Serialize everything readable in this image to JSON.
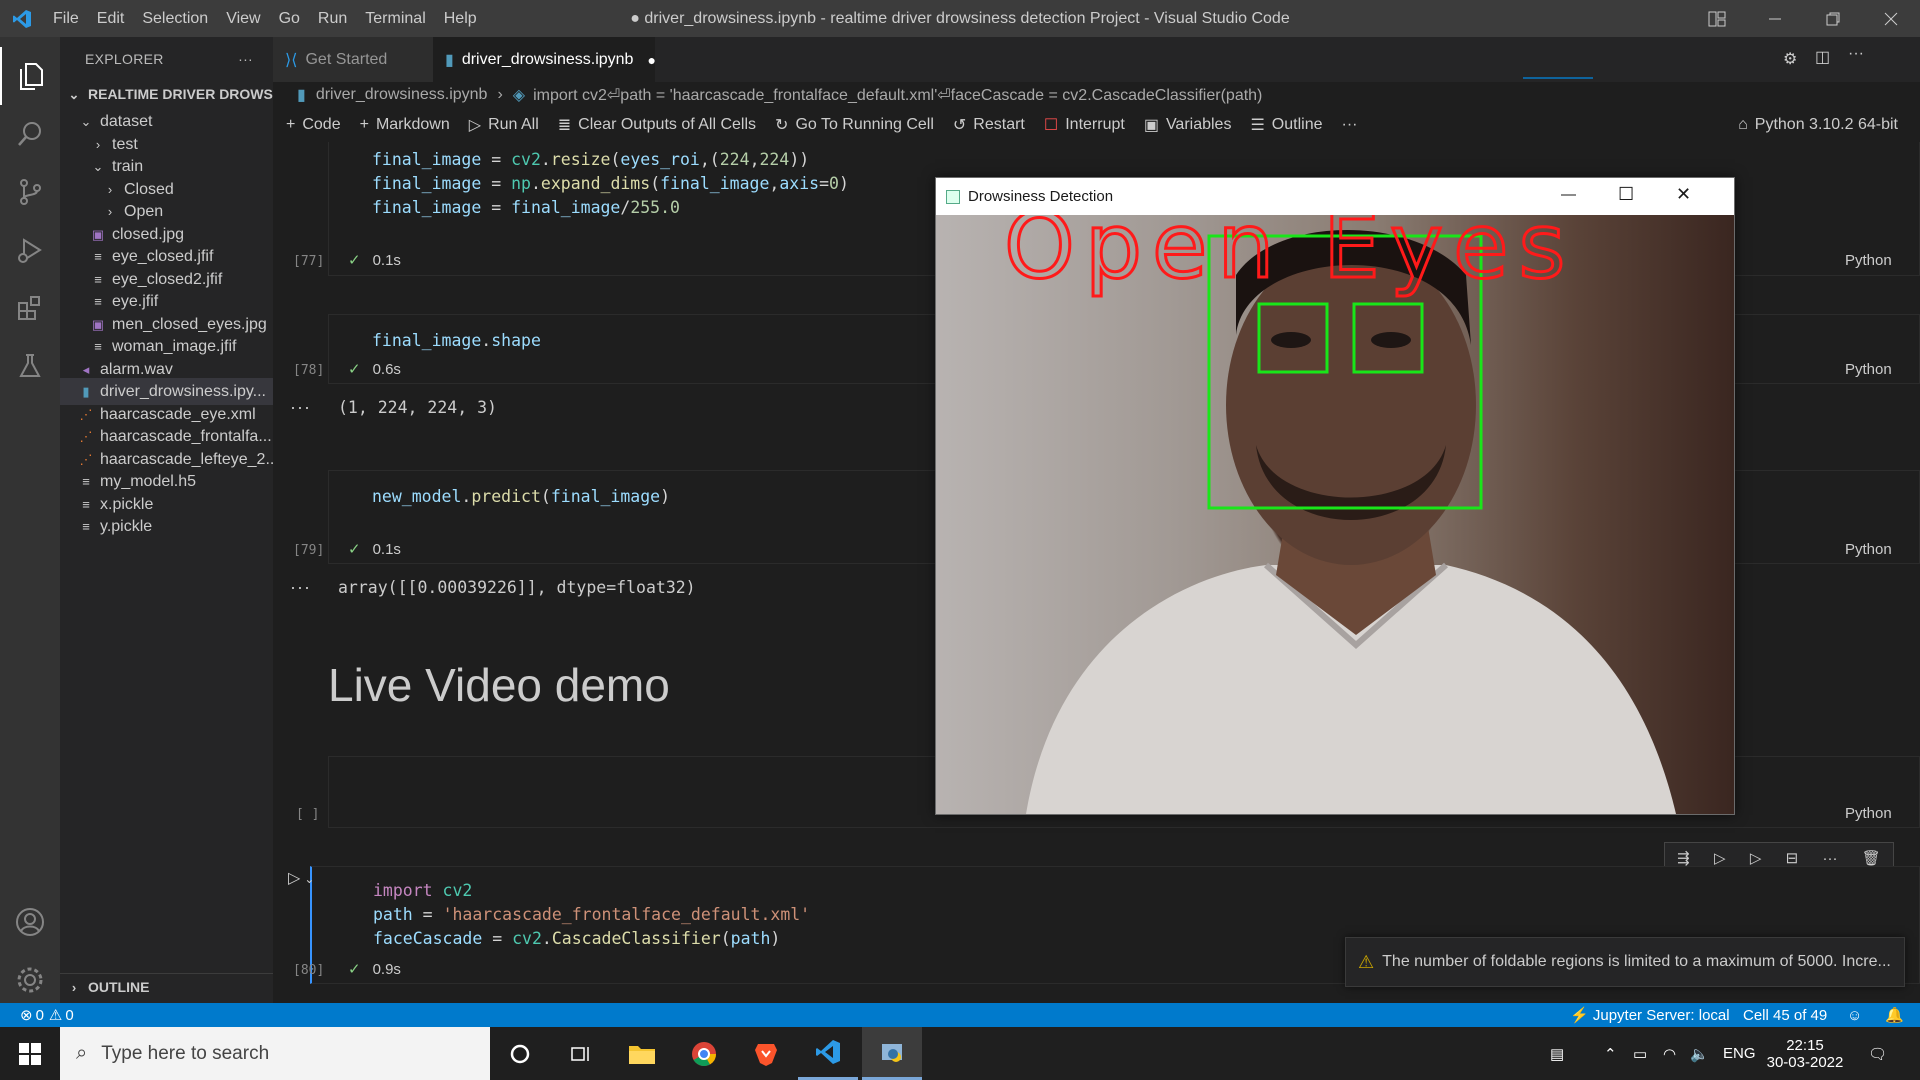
{
  "titlebar": {
    "menu": [
      "File",
      "Edit",
      "Selection",
      "View",
      "Go",
      "Run",
      "Terminal",
      "Help"
    ],
    "title": "● driver_drowsiness.ipynb - realtime driver drowsiness detection Project - Visual Studio Code"
  },
  "sidebar": {
    "header": "EXPLORER",
    "root": "REALTIME DRIVER DROWS...",
    "items": [
      {
        "label": "dataset",
        "kind": "folder-open"
      },
      {
        "label": "test",
        "kind": "folder"
      },
      {
        "label": "train",
        "kind": "folder-open"
      },
      {
        "label": "Closed",
        "kind": "folder"
      },
      {
        "label": "Open",
        "kind": "folder"
      },
      {
        "label": "closed.jpg",
        "kind": "image"
      },
      {
        "label": "eye_closed.jfif",
        "kind": "file"
      },
      {
        "label": "eye_closed2.jfif",
        "kind": "file"
      },
      {
        "label": "eye.jfif",
        "kind": "file"
      },
      {
        "label": "men_closed_eyes.jpg",
        "kind": "image"
      },
      {
        "label": "woman_image.jfif",
        "kind": "file"
      },
      {
        "label": "alarm.wav",
        "kind": "audio"
      },
      {
        "label": "driver_drowsiness.ipy...",
        "kind": "notebook"
      },
      {
        "label": "haarcascade_eye.xml",
        "kind": "rss"
      },
      {
        "label": "haarcascade_frontalfa...",
        "kind": "rss"
      },
      {
        "label": "haarcascade_lefteye_2...",
        "kind": "rss"
      },
      {
        "label": "my_model.h5",
        "kind": "file"
      },
      {
        "label": "x.pickle",
        "kind": "file"
      },
      {
        "label": "y.pickle",
        "kind": "file"
      }
    ],
    "outline": "OUTLINE"
  },
  "tabs": [
    {
      "label": "Get Started"
    },
    {
      "label": "driver_drowsiness.ipynb"
    }
  ],
  "breadcrumb": {
    "file": "driver_drowsiness.ipynb",
    "cell": "import cv2⏎path = 'haarcascade_frontalface_default.xml'⏎faceCascade = cv2.CascadeClassifier(path)"
  },
  "toolbar": {
    "code": "Code",
    "markdown": "Markdown",
    "run_all": "Run All",
    "clear": "Clear Outputs of All Cells",
    "goto": "Go To Running Cell",
    "restart": "Restart",
    "interrupt": "Interrupt",
    "variables": "Variables",
    "outline": "Outline",
    "kernel": "Python 3.10.2 64-bit"
  },
  "cells": {
    "c77": {
      "exec": "[77]",
      "time": "0.1s",
      "lang": "Python"
    },
    "c78": {
      "exec": "[78]",
      "time": "0.6s",
      "lang": "Python",
      "output": "(1, 224, 224, 3)"
    },
    "c79": {
      "exec": "[79]",
      "time": "0.1s",
      "lang": "Python",
      "output": "array([[0.00039226]], dtype=float32)"
    },
    "markdown_heading": "Live Video demo",
    "empty": {
      "exec": "[ ]",
      "lang": "Python"
    },
    "c80": {
      "exec": "[80]",
      "time": "0.9s"
    }
  },
  "window": {
    "title": "Drowsiness Detection",
    "overlay_text": "Open Eyes"
  },
  "notification": "The number of foldable regions is limited to a maximum of 5000. Incre...",
  "statusbar": {
    "errors": "0",
    "warnings": "0",
    "jupyter": "Jupyter Server: local",
    "cell": "Cell 45 of 49"
  },
  "taskbar": {
    "search_placeholder": "Type here to search",
    "lang": "ENG",
    "time": "22:15",
    "date": "30-03-2022"
  }
}
